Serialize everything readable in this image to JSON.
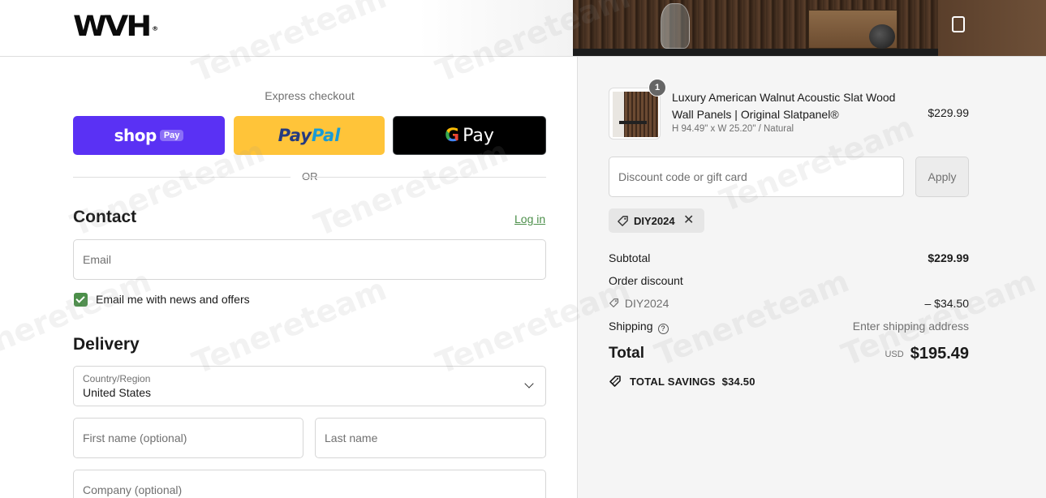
{
  "header": {
    "logo_text": "WVH",
    "logo_mark": "®"
  },
  "express": {
    "title": "Express checkout",
    "shop_label": "shop",
    "shop_pay_badge": "Pay",
    "paypal_part1": "Pay",
    "paypal_part2": "Pal",
    "gpay_g": "G",
    "gpay_word": "Pay",
    "or_text": "OR"
  },
  "contact": {
    "title": "Contact",
    "login_link": "Log in",
    "email_placeholder": "Email",
    "newsletter_label": "Email me with news and offers",
    "newsletter_checked": true
  },
  "delivery": {
    "title": "Delivery",
    "country_label": "Country/Region",
    "country_value": "United States",
    "first_name_placeholder": "First name (optional)",
    "last_name_placeholder": "Last name",
    "company_placeholder": "Company (optional)"
  },
  "cart": {
    "item_quantity": "1",
    "item_title": "Luxury American Walnut Acoustic Slat Wood Wall Panels | Original Slatpanel®",
    "item_variant": "H 94.49\" x W 25.20\" / Natural",
    "item_price": "$229.99",
    "discount_placeholder": "Discount code or gift card",
    "apply_label": "Apply",
    "applied_code": "DIY2024",
    "remove_glyph": "✕"
  },
  "summary": {
    "subtotal_label": "Subtotal",
    "subtotal_value": "$229.99",
    "order_discount_label": "Order discount",
    "discount_code": "DIY2024",
    "discount_value": "– $34.50",
    "shipping_label": "Shipping",
    "shipping_value": "Enter shipping address",
    "total_label": "Total",
    "currency": "USD",
    "total_value": "$195.49",
    "savings_label": "TOTAL SAVINGS",
    "savings_value": "$34.50"
  },
  "icons": {
    "help": "?",
    "cart": "shopping-bag-icon",
    "tag": "tag-icon",
    "chevron": "chevron-down-icon"
  },
  "colors": {
    "shop_pay": "#5a31f4",
    "paypal": "#ffc439",
    "gpay": "#000000",
    "link": "#4c8f4a"
  },
  "watermark": "Tenereteam"
}
